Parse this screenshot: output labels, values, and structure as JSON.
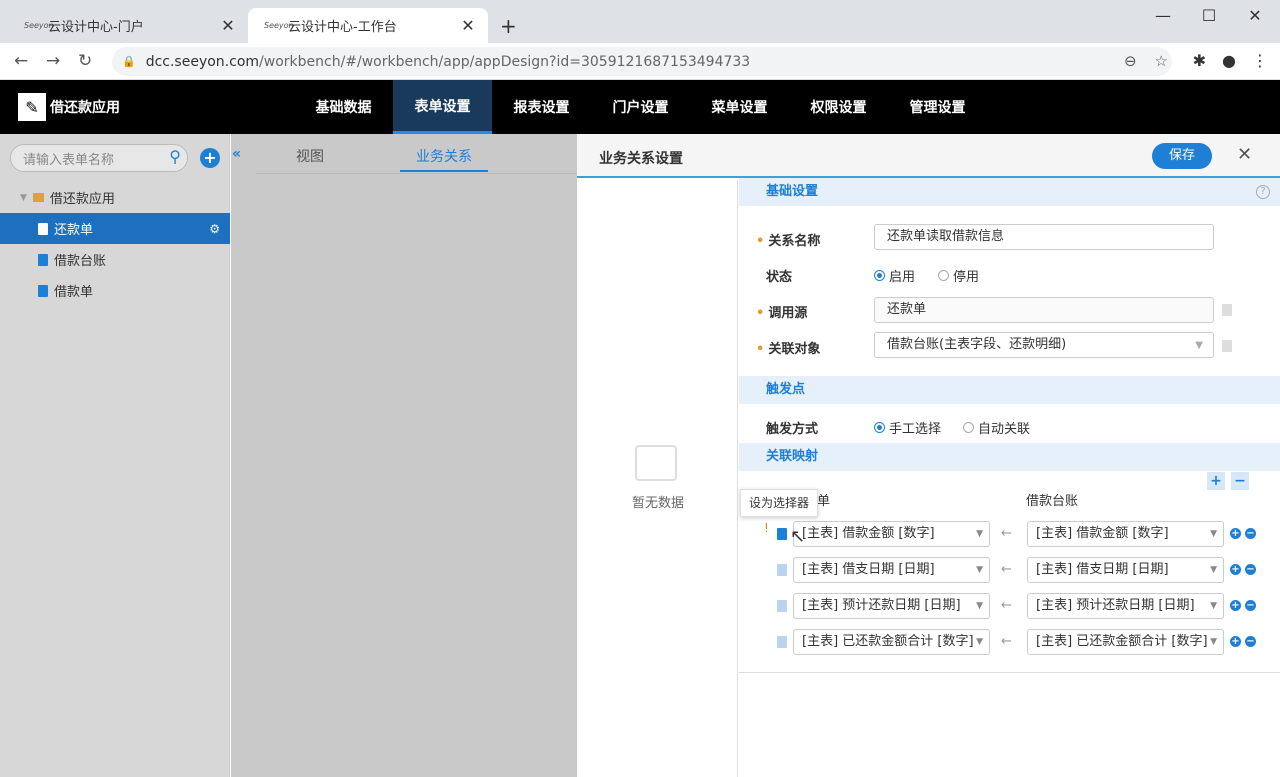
{
  "browser": {
    "tabs": [
      {
        "title": "云设计中心-门户",
        "favicon": "Seeyon"
      },
      {
        "title": "云设计中心-工作台",
        "favicon": "Seeyon"
      }
    ],
    "url_host": "dcc.seeyon.com",
    "url_path": "/workbench/#/workbench/app/appDesign?id=3059121687153494733"
  },
  "app": {
    "name": "借还款应用",
    "menu": [
      "基础数据",
      "表单设置",
      "报表设置",
      "门户设置",
      "菜单设置",
      "权限设置",
      "管理设置"
    ],
    "active_menu": "表单设置"
  },
  "sidebar": {
    "search_placeholder": "请输入表单名称",
    "tree": {
      "root": "借还款应用",
      "items": [
        "还款单",
        "借款台账",
        "借款单"
      ],
      "selected": "还款单"
    }
  },
  "center": {
    "tabs": [
      "视图",
      "业务关系"
    ],
    "active_tab": "业务关系"
  },
  "panel": {
    "title": "业务关系设置",
    "save_label": "保存",
    "empty_text": "暂无数据",
    "sections": {
      "basic": "基础设置",
      "trigger": "触发点",
      "mapping": "关联映射"
    },
    "fields": {
      "relation_name_label": "关系名称",
      "relation_name_value": "还款单读取借款信息",
      "status_label": "状态",
      "status_on": "启用",
      "status_off": "停用",
      "source_label": "调用源",
      "source_value": "还款单",
      "target_label": "关联对象",
      "target_value": "借款台账(主表字段、还款明细)",
      "trigger_label": "触发方式",
      "trigger_manual": "手工选择",
      "trigger_auto": "自动关联"
    },
    "mapping": {
      "left_col_suffix": "单",
      "right_col": "借款台账",
      "tooltip": "设为选择器",
      "rows": [
        {
          "left": "[主表] 借款金额 [数字]",
          "right": "[主表] 借款金额 [数字]",
          "flag": "!"
        },
        {
          "left": "[主表] 借支日期 [日期]",
          "right": "[主表] 借支日期 [日期]",
          "flag": ""
        },
        {
          "left": "[主表] 预计还款日期 [日期]",
          "right": "[主表] 预计还款日期 [日期]",
          "flag": ""
        },
        {
          "left": "[主表] 已还款金额合计 [数字]",
          "right": "[主表] 已还款金额合计 [数字]",
          "flag": ""
        }
      ]
    }
  },
  "colors": {
    "accent": "#1d7fd6",
    "appbar": "#000000"
  }
}
